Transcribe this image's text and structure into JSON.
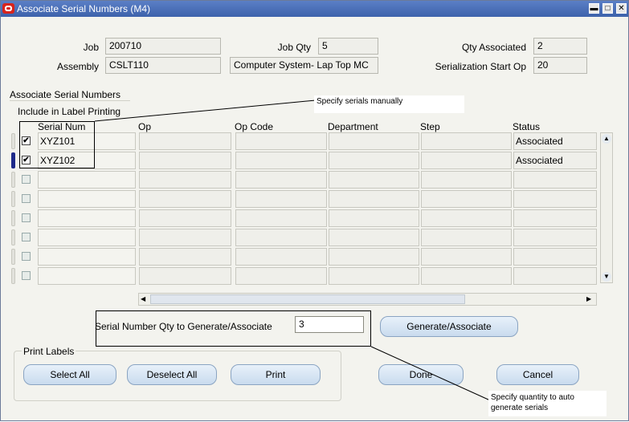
{
  "window": {
    "title": "Associate Serial Numbers (M4)"
  },
  "header": {
    "job_label": "Job",
    "job_value": "200710",
    "job_qty_label": "Job Qty",
    "job_qty_value": "5",
    "qty_associated_label": "Qty Associated",
    "qty_associated_value": "2",
    "assembly_label": "Assembly",
    "assembly_value": "CSLT110",
    "assembly_desc": "Computer System- Lap Top MC",
    "serial_start_op_label": "Serialization Start Op",
    "serial_start_op_value": "20"
  },
  "section": {
    "title": "Associate Serial Numbers",
    "include_label": "Include in Label Printing"
  },
  "table": {
    "columns": [
      "Serial Num",
      "Op",
      "Op Code",
      "Department",
      "Step",
      "Status"
    ],
    "rows": [
      {
        "checked": true,
        "serial": "XYZ101",
        "op": "",
        "op_code": "",
        "department": "",
        "step": "",
        "status": "Associated"
      },
      {
        "checked": true,
        "serial": "XYZ102",
        "op": "",
        "op_code": "",
        "department": "",
        "step": "",
        "status": "Associated"
      },
      {
        "checked": false,
        "serial": "",
        "op": "",
        "op_code": "",
        "department": "",
        "step": "",
        "status": ""
      },
      {
        "checked": false,
        "serial": "",
        "op": "",
        "op_code": "",
        "department": "",
        "step": "",
        "status": ""
      },
      {
        "checked": false,
        "serial": "",
        "op": "",
        "op_code": "",
        "department": "",
        "step": "",
        "status": ""
      },
      {
        "checked": false,
        "serial": "",
        "op": "",
        "op_code": "",
        "department": "",
        "step": "",
        "status": ""
      },
      {
        "checked": false,
        "serial": "",
        "op": "",
        "op_code": "",
        "department": "",
        "step": "",
        "status": ""
      },
      {
        "checked": false,
        "serial": "",
        "op": "",
        "op_code": "",
        "department": "",
        "step": "",
        "status": ""
      }
    ]
  },
  "generate": {
    "label": "Serial Number Qty to Generate/Associate",
    "value": "3",
    "button": "Generate/Associate"
  },
  "print": {
    "group_title": "Print Labels",
    "select_all": "Select All",
    "deselect_all": "Deselect All",
    "print": "Print"
  },
  "footer": {
    "done": "Done",
    "cancel": "Cancel"
  },
  "callouts": {
    "manual": "Specify serials manually",
    "auto_line1": "Specify quantity to auto",
    "auto_line2": "generate serials"
  },
  "colors": {
    "title_bar": "#3d62ab",
    "field_bg": "#efefea",
    "button_bg": "#c9dbee",
    "current_row": "#1e2a8a"
  }
}
